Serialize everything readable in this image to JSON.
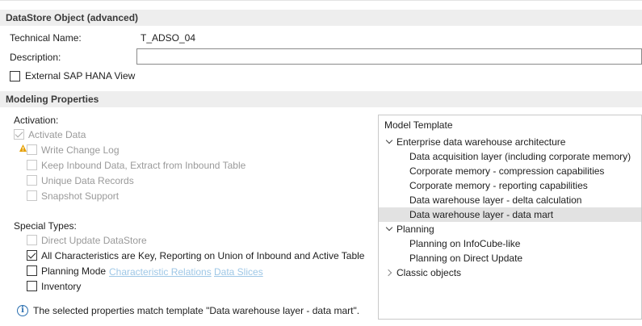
{
  "header": {
    "title": "DataStore Object (advanced)"
  },
  "general": {
    "technical_name_label": "Technical Name:",
    "technical_name_value": "T_ADSO_04",
    "description_label": "Description:",
    "description_value": "",
    "external_hana_view_label": "External SAP HANA View",
    "external_hana_view_checked": false
  },
  "modeling": {
    "title": "Modeling Properties",
    "activation_label": "Activation:",
    "activate_data_label": "Activate Data",
    "write_change_log_label": "Write Change Log",
    "keep_inbound_label": "Keep Inbound Data, Extract from Inbound Table",
    "unique_records_label": "Unique Data Records",
    "snapshot_label": "Snapshot Support",
    "special_types_label": "Special Types:",
    "direct_update_label": "Direct Update DataStore",
    "all_chars_key_label": "All Characteristics are Key, Reporting on Union of Inbound and Active Table",
    "planning_mode_label": "Planning Mode",
    "characteristic_relations_link": "Characteristic Relations",
    "data_slices_link": "Data Slices",
    "inventory_label": "Inventory",
    "info_message": "The selected properties match template \"Data warehouse layer - data mart\"."
  },
  "model_template": {
    "title": "Model Template",
    "groups": [
      {
        "label": "Enterprise data warehouse architecture",
        "expanded": true,
        "items": [
          "Data acquisition layer (including corporate memory)",
          "Corporate memory - compression capabilities",
          "Corporate memory - reporting capabilities",
          "Data warehouse layer - delta calculation",
          "Data warehouse layer - data mart"
        ]
      },
      {
        "label": "Planning",
        "expanded": true,
        "items": [
          "Planning on InfoCube-like",
          "Planning on Direct Update"
        ]
      },
      {
        "label": "Classic objects",
        "expanded": false,
        "items": []
      }
    ],
    "selected_item": "Data warehouse layer - data mart"
  },
  "colors": {
    "link": "#9ec7e6",
    "info_blue": "#2a6fb0",
    "warning_amber": "#e6a000",
    "selected_row": "#e2e2e2"
  }
}
